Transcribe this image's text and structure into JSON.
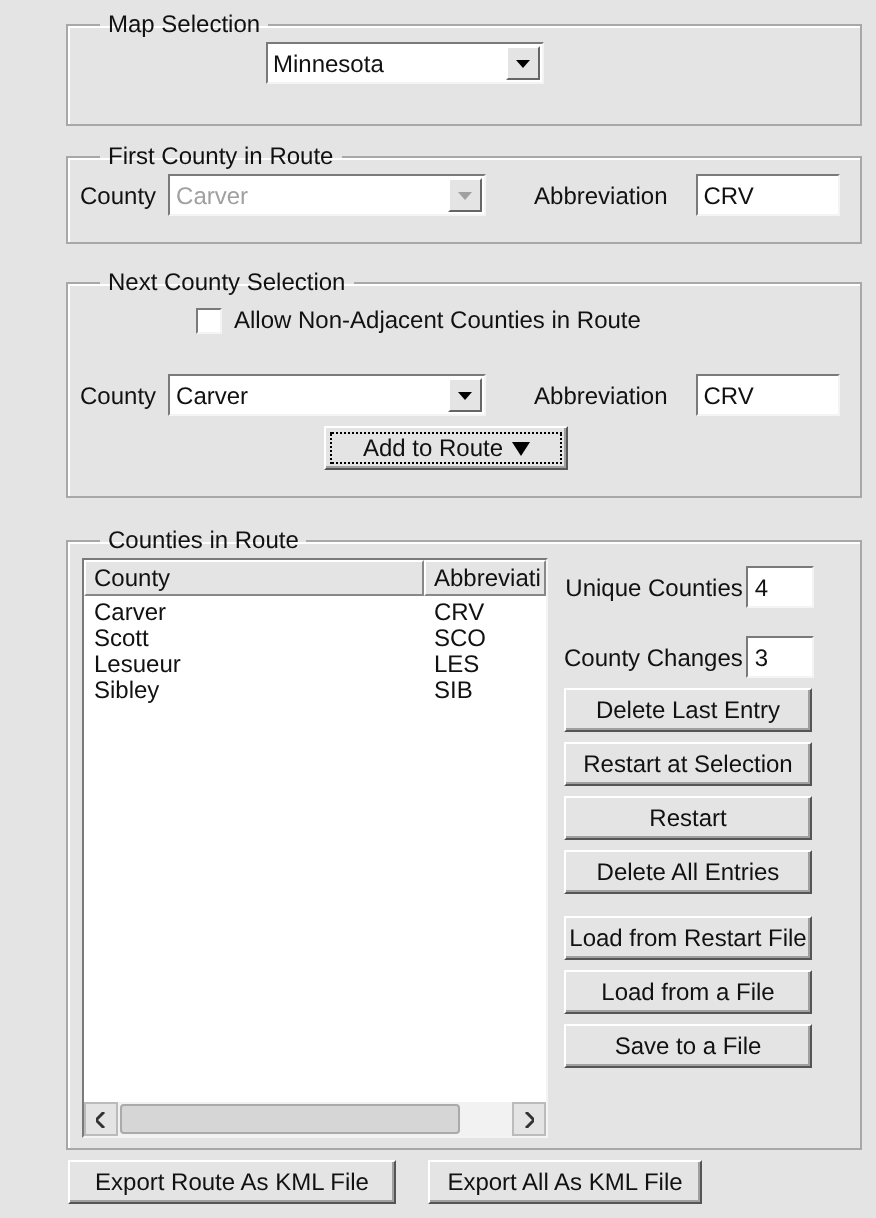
{
  "map_selection": {
    "title": "Map Selection",
    "state": "Minnesota"
  },
  "first_county": {
    "title": "First County in Route",
    "county_label": "County",
    "county": "Carver",
    "disabled": true,
    "abbreviation_label": "Abbreviation",
    "abbreviation": "CRV"
  },
  "next_county": {
    "title": "Next County Selection",
    "allow_non_adjacent": {
      "label": "Allow Non-Adjacent Counties in Route",
      "checked": false
    },
    "county_label": "County",
    "county": "Carver",
    "disabled": false,
    "abbreviation_label": "Abbreviation",
    "abbreviation": "CRV",
    "add_button": "Add to Route"
  },
  "counties_in_route": {
    "title": "Counties in Route",
    "columns": [
      "County",
      "Abbreviati"
    ],
    "rows": [
      [
        "Carver",
        "CRV"
      ],
      [
        "Scott",
        "SCO"
      ],
      [
        "Lesueur",
        "LES"
      ],
      [
        "Sibley",
        "SIB"
      ]
    ],
    "unique_label": "Unique Counties",
    "unique": "4",
    "changes_label": "County Changes",
    "changes": "3",
    "button_groups": [
      [
        "Delete Last Entry",
        "Restart at Selection",
        "Restart",
        "Delete All Entries"
      ],
      [
        "Load from Restart File",
        "Load from a File",
        "Save to a File"
      ]
    ]
  },
  "bottom_buttons": [
    "Export Route As KML File",
    "Export All As KML File"
  ]
}
